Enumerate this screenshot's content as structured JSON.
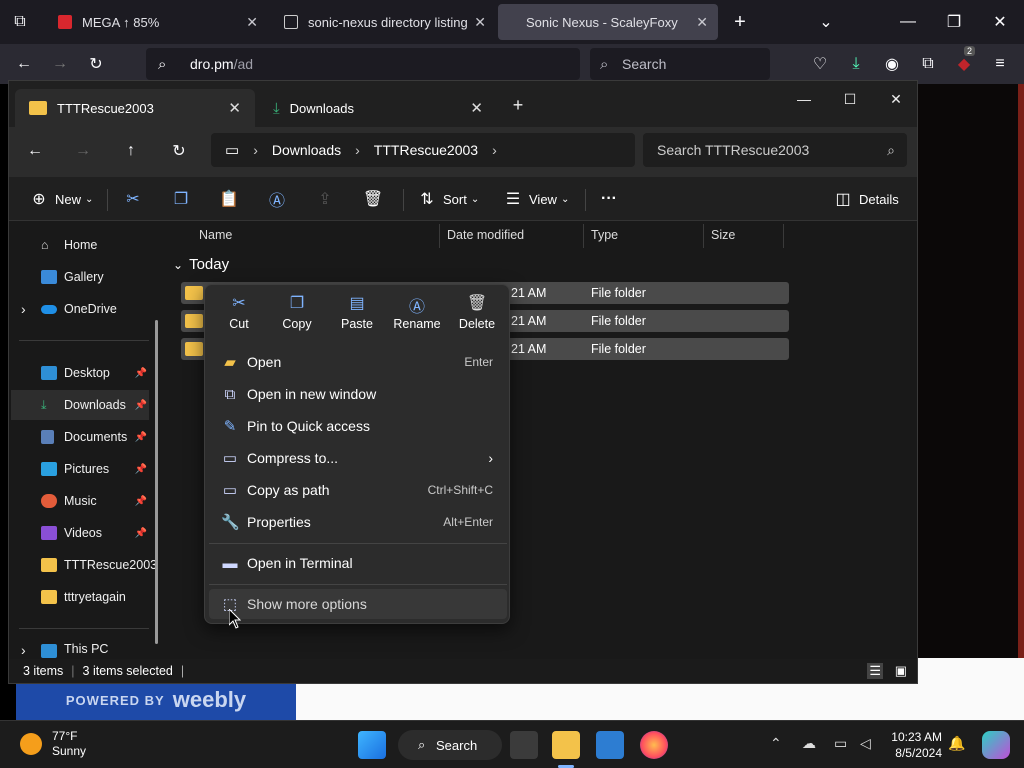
{
  "browser": {
    "tabs": [
      {
        "label": "MEGA ↑ 85%"
      },
      {
        "label": "sonic-nexus directory listing"
      },
      {
        "label": "Sonic Nexus - ScaleyFoxy"
      }
    ],
    "url_host": "dro.pm",
    "url_path": "/ad",
    "search_placeholder": "Search",
    "badge_count": "2"
  },
  "webpage": {
    "powered_by": "POWERED BY",
    "weebly": "weebly"
  },
  "explorer": {
    "tabs": [
      {
        "label": "TTTRescue2003"
      },
      {
        "label": "Downloads"
      }
    ],
    "breadcrumb": [
      "Downloads",
      "TTTRescue2003"
    ],
    "search_placeholder": "Search TTTRescue2003",
    "commands": {
      "new": "New",
      "sort": "Sort",
      "view": "View",
      "details": "Details"
    },
    "sidebar": [
      {
        "label": "Home"
      },
      {
        "label": "Gallery"
      },
      {
        "label": "OneDrive"
      },
      {
        "label": "Desktop"
      },
      {
        "label": "Downloads"
      },
      {
        "label": "Documents"
      },
      {
        "label": "Pictures"
      },
      {
        "label": "Music"
      },
      {
        "label": "Videos"
      },
      {
        "label": "TTTRescue2003"
      },
      {
        "label": "tttryetagain"
      },
      {
        "label": "This PC"
      }
    ],
    "columns": {
      "name": "Name",
      "date": "Date modified",
      "type": "Type",
      "size": "Size"
    },
    "group": "Today",
    "rows": [
      {
        "date": "21 AM",
        "type": "File folder"
      },
      {
        "date": "21 AM",
        "type": "File folder"
      },
      {
        "date": "21 AM",
        "type": "File folder"
      }
    ],
    "status": {
      "count": "3 items",
      "selected": "3 items selected"
    }
  },
  "context_menu": {
    "quick_actions": [
      {
        "label": "Cut"
      },
      {
        "label": "Copy"
      },
      {
        "label": "Paste"
      },
      {
        "label": "Rename"
      },
      {
        "label": "Delete"
      }
    ],
    "items": [
      {
        "label": "Open",
        "shortcut": "Enter"
      },
      {
        "label": "Open in new window",
        "shortcut": ""
      },
      {
        "label": "Pin to Quick access",
        "shortcut": ""
      },
      {
        "label": "Compress to...",
        "shortcut": ""
      },
      {
        "label": "Copy as path",
        "shortcut": "Ctrl+Shift+C"
      },
      {
        "label": "Properties",
        "shortcut": "Alt+Enter"
      },
      {
        "label": "Open in Terminal",
        "shortcut": ""
      },
      {
        "label": "Show more options",
        "shortcut": ""
      }
    ]
  },
  "taskbar": {
    "weather_temp": "77°F",
    "weather_desc": "Sunny",
    "search_label": "Search",
    "time": "10:23 AM",
    "date": "8/5/2024"
  }
}
